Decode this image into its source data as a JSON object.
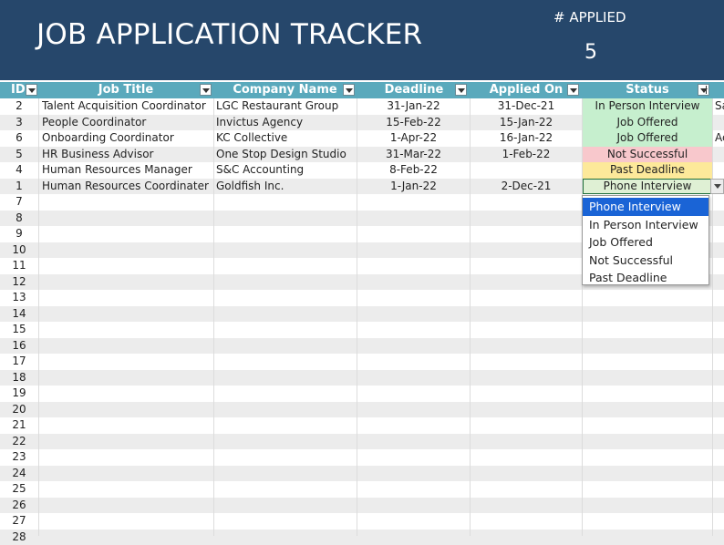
{
  "header": {
    "title": "JOB APPLICATION TRACKER",
    "applied_label": "# APPLIED",
    "applied_count": "5"
  },
  "columns": [
    "ID",
    "Job Title",
    "Company Name",
    "Deadline",
    "Applied On",
    "Status"
  ],
  "rows": [
    {
      "id": "2",
      "job_title": "Talent Acquisition Coordinator",
      "company": "LGC Restaurant Group",
      "deadline": "31-Jan-22",
      "applied_on": "31-Dec-21",
      "status": "In Person Interview",
      "extra": "Sa"
    },
    {
      "id": "3",
      "job_title": "People Coordinator",
      "company": "Invictus Agency",
      "deadline": "15-Feb-22",
      "applied_on": "15-Jan-22",
      "status": "Job Offered",
      "extra": ""
    },
    {
      "id": "6",
      "job_title": "Onboarding Coordinator",
      "company": "KC Collective",
      "deadline": "1-Apr-22",
      "applied_on": "16-Jan-22",
      "status": "Job Offered",
      "extra": "Ac"
    },
    {
      "id": "5",
      "job_title": "HR Business Advisor",
      "company": "One Stop Design Studio",
      "deadline": "31-Mar-22",
      "applied_on": "1-Feb-22",
      "status": "Not Successful",
      "extra": ""
    },
    {
      "id": "4",
      "job_title": "Human Resources Manager",
      "company": "S&C Accounting",
      "deadline": "8-Feb-22",
      "applied_on": "",
      "status": "Past Deadline",
      "extra": ""
    },
    {
      "id": "1",
      "job_title": "Human Resources Coordinater",
      "company": "Goldfish Inc.",
      "deadline": "1-Jan-22",
      "applied_on": "2-Dec-21",
      "status": "Phone Interview",
      "extra": ""
    }
  ],
  "empty_row_ids": [
    "7",
    "8",
    "9",
    "10",
    "11",
    "12",
    "13",
    "14",
    "15",
    "16",
    "17",
    "18",
    "19",
    "20",
    "21",
    "22",
    "23",
    "24",
    "25",
    "26",
    "27",
    "28"
  ],
  "status_colors": {
    "In Person Interview": "#c6efce",
    "Job Offered": "#c6efce",
    "Not Successful": "#f8c8cc",
    "Past Deadline": "#fde99a",
    "Phone Interview": "#dff0d4"
  },
  "dropdown": {
    "options": [
      "Phone Interview",
      "In Person Interview",
      "Job Offered",
      "Not Successful",
      "Past Deadline"
    ],
    "selected": "Phone Interview"
  },
  "colors": {
    "banner": "#26476b",
    "header_row": "#5aa9bc",
    "selection": "#1a64d6"
  }
}
